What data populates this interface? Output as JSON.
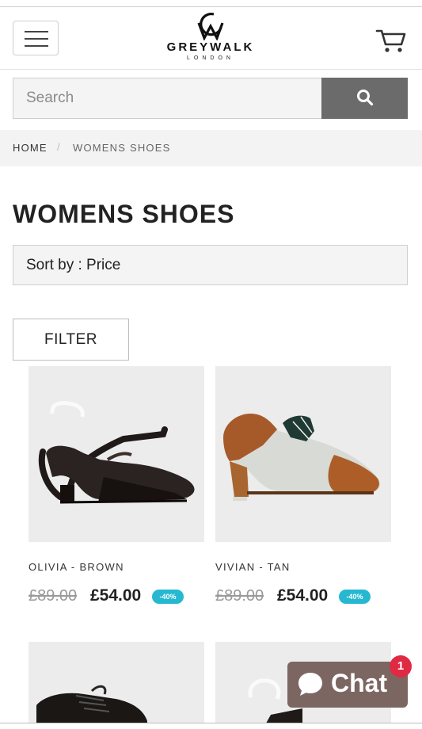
{
  "header": {
    "menu_icon": "hamburger-icon",
    "logo_title": "GREYWALK",
    "logo_subtitle": "LONDON",
    "cart_icon": "cart-icon"
  },
  "search": {
    "placeholder": "Search",
    "value": "",
    "button_icon": "search-icon"
  },
  "breadcrumb": {
    "home": "HOME",
    "separator": "/",
    "current": "WOMENS SHOES"
  },
  "page_title": "WOMENS SHOES",
  "sort": {
    "label": "Sort by : Price"
  },
  "filter": {
    "label": "FILTER"
  },
  "products": [
    {
      "name": "OLIVIA - BROWN",
      "old_price": "£89.00",
      "price": "£54.00",
      "discount": "-40%"
    },
    {
      "name": "VIVIAN - TAN",
      "old_price": "£89.00",
      "price": "£54.00",
      "discount": "-40%"
    }
  ],
  "chat": {
    "label": "Chat",
    "unread_count": "1",
    "icon": "chat-bubble-icon"
  },
  "colors": {
    "search_button": "#6b6b6b",
    "discount_badge": "#25b8d0",
    "chat_button": "#7c6661",
    "notification_badge": "#e02a43"
  }
}
